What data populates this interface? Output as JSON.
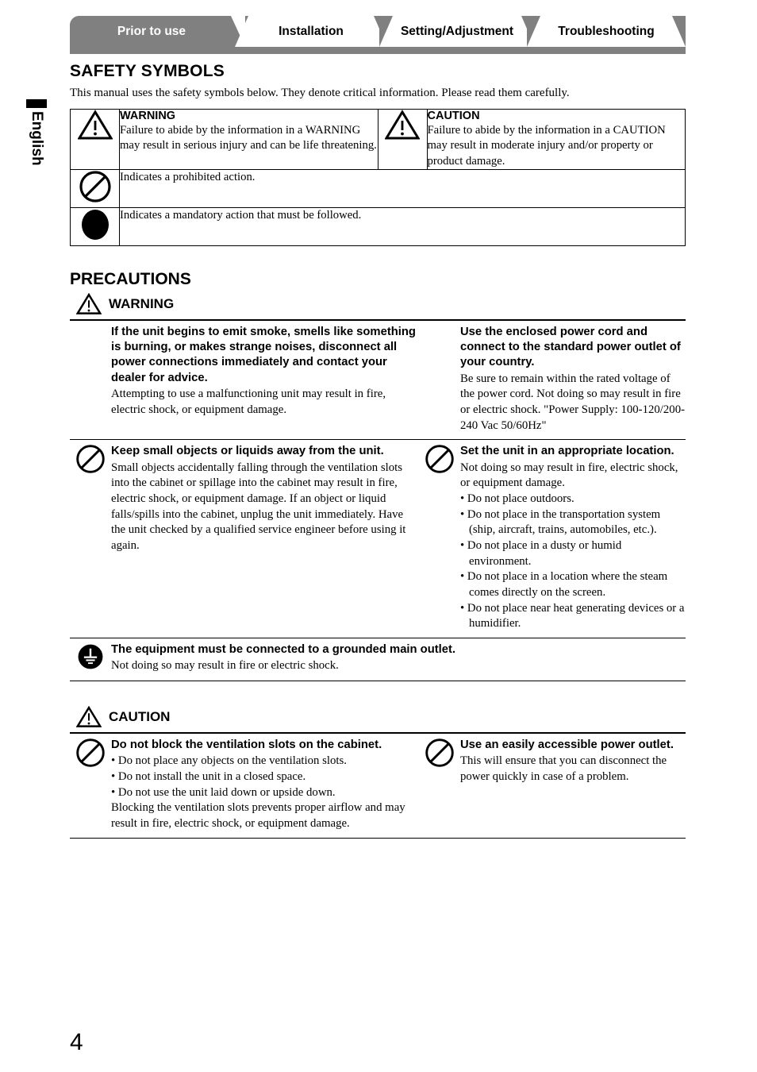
{
  "side_tab": {
    "label": "English"
  },
  "tabs": [
    {
      "label": "Prior to use",
      "active": true
    },
    {
      "label": "Installation",
      "active": false
    },
    {
      "label": "Setting/Adjustment",
      "active": false
    },
    {
      "label": "Troubleshooting",
      "active": false
    }
  ],
  "safety_symbols": {
    "heading": "SAFETY SYMBOLS",
    "intro": "This manual uses the safety symbols below. They denote critical information. Please read them carefully.",
    "cells": [
      {
        "icon": "warning-triangle-icon",
        "title": "WARNING",
        "body": "Failure to abide by the information in a WARNING may result in serious injury and can be life threatening."
      },
      {
        "icon": "warning-triangle-icon",
        "title": "CAUTION",
        "body": "Failure to abide by the information in a CAUTION may result in moderate injury and/or property or product damage."
      }
    ],
    "rows": [
      {
        "icon": "prohibition-icon",
        "text": "Indicates a prohibited action."
      },
      {
        "icon": "mandatory-icon",
        "text": "Indicates a mandatory action that must be followed."
      }
    ]
  },
  "precautions": {
    "heading": "PRECAUTIONS",
    "warning": {
      "label": "WARNING",
      "icon": "warning-triangle-icon",
      "rows": [
        {
          "left": {
            "icon": "none",
            "title": "If the unit begins to emit smoke, smells like something is burning, or makes strange noises, disconnect all power connections immediately and contact your dealer for advice.",
            "body": "Attempting to use a malfunctioning unit may result in fire, electric shock, or equipment damage.",
            "bullets": []
          },
          "right": {
            "icon": "none",
            "title": "Use the enclosed power cord and connect to the standard power outlet of your country.",
            "body": "Be sure to remain within the rated voltage of the power cord. Not doing so may result in fire or electric shock. \"Power Supply: 100-120/200-240 Vac 50/60Hz\"",
            "bullets": []
          }
        },
        {
          "left": {
            "icon": "prohibition-icon",
            "title": "Keep small objects or liquids away from the unit.",
            "body": "Small objects accidentally falling through the ventilation slots into the cabinet or spillage into the cabinet may result in fire, electric shock, or equipment damage. If an object or liquid falls/spills into the cabinet, unplug the unit immediately. Have the unit checked by a qualified service engineer before using it again.",
            "bullets": []
          },
          "right": {
            "icon": "prohibition-icon",
            "title": "Set the unit in an appropriate location.",
            "body": "Not doing so may result in fire, electric shock, or equipment damage.",
            "bullets": [
              "Do not place outdoors.",
              "Do not place in the transportation system (ship, aircraft, trains, automobiles, etc.).",
              "Do not place in a dusty or humid environment.",
              "Do not place in a location where the steam comes directly on the screen.",
              "Do not place near heat generating devices or a humidifier."
            ]
          }
        }
      ],
      "full_row": {
        "icon": "ground-icon",
        "title": "The equipment must be connected to a grounded main outlet.",
        "body": "Not doing so may result in fire or electric shock."
      }
    },
    "caution": {
      "label": "CAUTION",
      "icon": "warning-triangle-icon",
      "rows": [
        {
          "left": {
            "icon": "prohibition-icon",
            "title": "Do not block the ventilation slots on the cabinet.",
            "bullets": [
              "Do not place any objects on the ventilation slots.",
              "Do not install the unit in a closed space.",
              "Do not use the unit laid down or upside down."
            ],
            "body": "Blocking the ventilation slots prevents proper airflow and may result in fire, electric shock, or equipment damage."
          },
          "right": {
            "icon": "prohibition-icon",
            "title": "Use an easily accessible power outlet.",
            "bullets": [],
            "body": "This will ensure that you can disconnect the power quickly in case of a problem."
          }
        }
      ]
    }
  },
  "page_number": "4",
  "colors": {
    "tab_gray": "#808080",
    "text": "#000000"
  }
}
